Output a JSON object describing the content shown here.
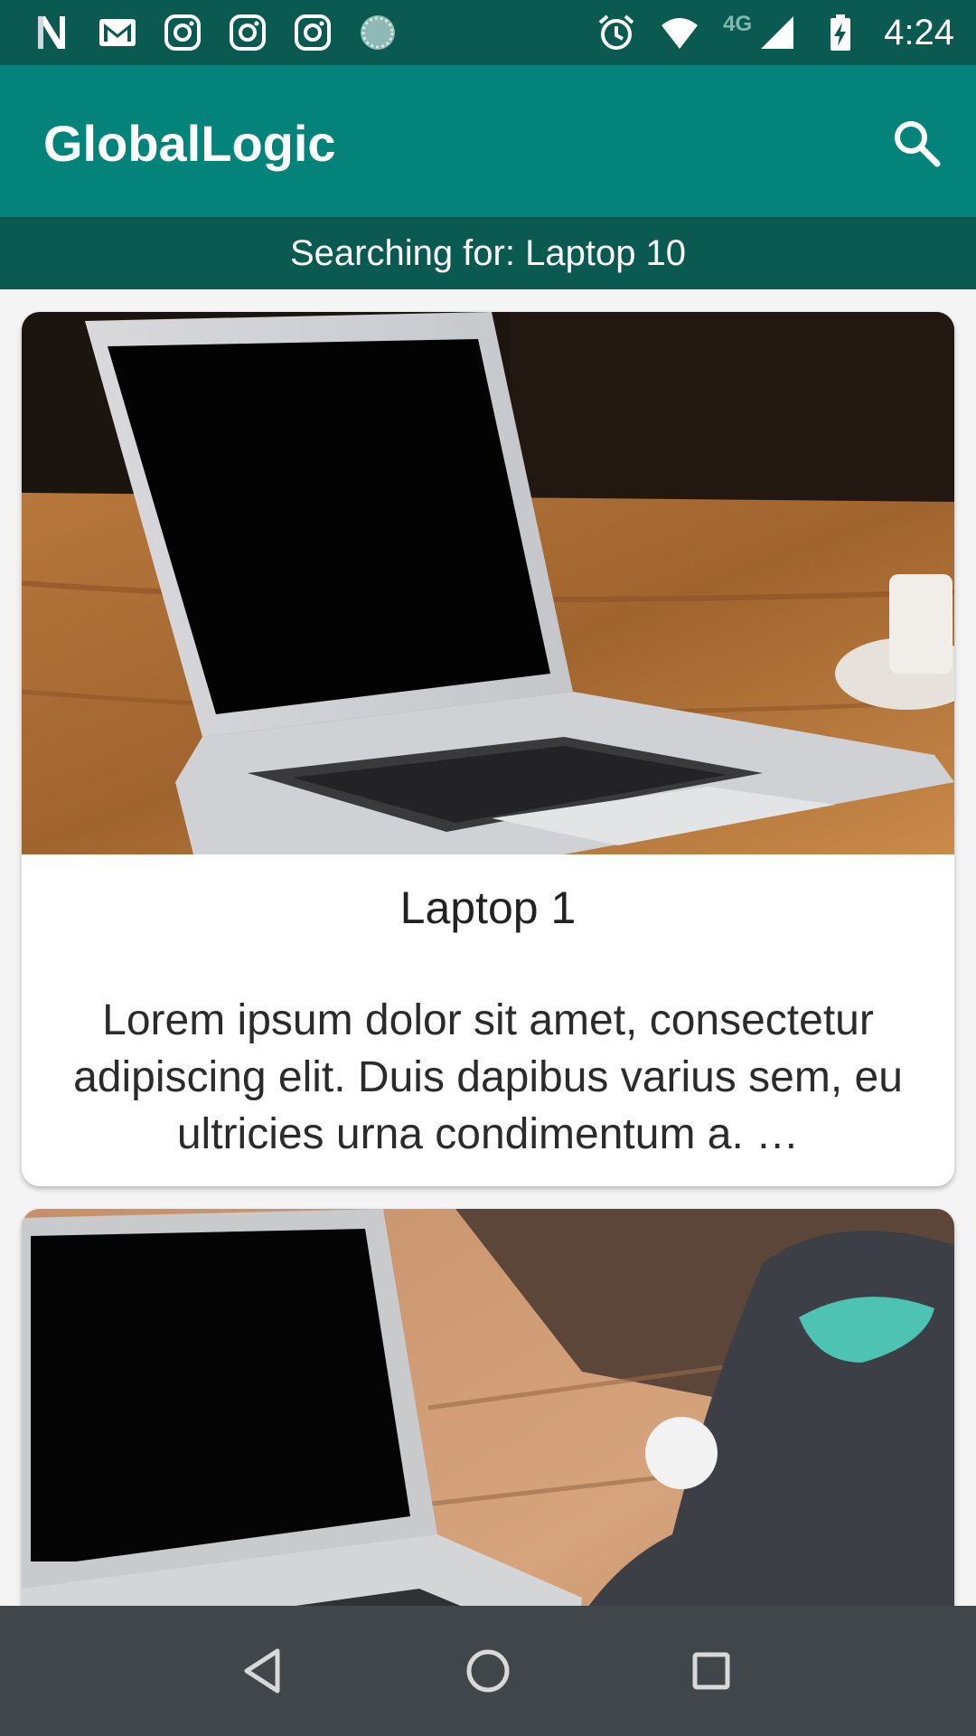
{
  "status_bar": {
    "time": "4:24",
    "network": "4G",
    "left_icons": [
      "n-icon",
      "gmail-icon",
      "instagram-icon",
      "instagram-icon",
      "instagram-icon",
      "loading-icon"
    ],
    "right_icons": [
      "alarm-icon",
      "wifi-icon",
      "signal-icon",
      "battery-charging-icon"
    ]
  },
  "app_bar": {
    "title": "GlobalLogic",
    "search_icon": "search-icon"
  },
  "search_banner": {
    "text": "Searching for: Laptop 10"
  },
  "cards": [
    {
      "title": "Laptop 1",
      "description": "Lorem ipsum dolor sit amet, consectetur adipiscing elit. Duis dapibus varius sem, eu ultricies urna condimentum a. …"
    },
    {
      "title": "",
      "description": ""
    }
  ],
  "nav_bar": {
    "icons": [
      "back-icon",
      "home-icon",
      "recents-icon"
    ]
  },
  "colors": {
    "status_bar": "#0a5a52",
    "app_bar": "#04837a",
    "banner": "#0a5a52",
    "nav_bar": "#41464a",
    "background": "#f4f4f4"
  }
}
